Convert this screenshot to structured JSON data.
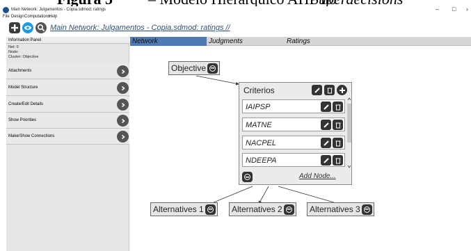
{
  "document_caption": {
    "figure_label": "Figura 5",
    "caption_text": "– Modelo Hierárquico AHP no",
    "caption_italic": "Superdecisions"
  },
  "window": {
    "title": "Main Network: Julgamentos - Copia.sdmod: ratings",
    "minimize": "–",
    "maximize": "□",
    "close": "›"
  },
  "menu": {
    "items": [
      "File",
      "Design",
      "Computations",
      "Help"
    ]
  },
  "toolbar": {
    "breadcrumb_main": "Main Network",
    "breadcrumb_sep": ": ",
    "breadcrumb_file": "Julgamentos - Copia.sdmod",
    "breadcrumb_view": ": ratings",
    "breadcrumb_end": " //"
  },
  "info_panel": {
    "header": "Information Panel",
    "net": "Net: 0",
    "node": "Node:",
    "cluster": "Cluster: Objective",
    "rows": [
      "Attachments",
      "Model Structure",
      "Create/Edit Details",
      "Show Priorities",
      "Make/Show Connections"
    ]
  },
  "tabs": {
    "items": [
      "Network",
      "Judgments",
      "Ratings"
    ],
    "active": "Network"
  },
  "network": {
    "objective": "Objective",
    "criteria_cluster": {
      "title": "Criterios",
      "nodes": [
        "IAIPSP",
        "MATNE",
        "NACPEL",
        "NDEEPA"
      ],
      "add_node": "Add Node..."
    },
    "alternatives": [
      "Alternatives 1",
      "Alternatives 2",
      "Alternatives 3"
    ]
  },
  "colors": {
    "active_tab": "#4f7ab2",
    "breadcrumb": "#2e4f72",
    "panel_bg": "#e6e6e6",
    "button_dark": "#333333",
    "toolbar_blue": "#1d9be0"
  }
}
